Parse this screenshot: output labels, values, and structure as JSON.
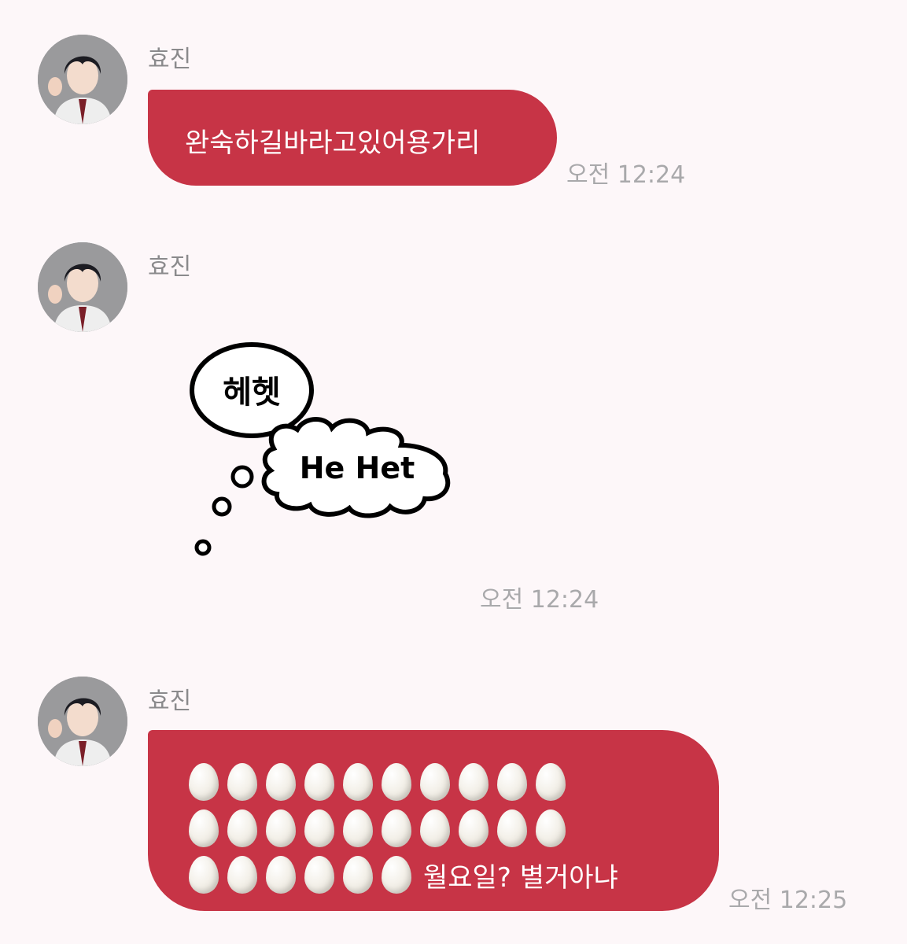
{
  "messages": [
    {
      "sender": "효진",
      "type": "text",
      "text": "완숙하길바라고있어용가리",
      "time": "오전 12:24"
    },
    {
      "sender": "효진",
      "type": "sticker",
      "sticker": {
        "korean": "헤헷",
        "english": "He Het"
      },
      "time": "오전 12:24"
    },
    {
      "sender": "효진",
      "type": "emoji-text",
      "emoji_icon": "egg-icon",
      "emoji_counts": [
        10,
        10,
        6
      ],
      "text": "월요일? 별거아냐",
      "time": "오전 12:25"
    }
  ],
  "colors": {
    "bubble": "#c73446",
    "background": "#fdf7f9",
    "time": "#a9a9ab",
    "sender": "#8a8a8c"
  }
}
